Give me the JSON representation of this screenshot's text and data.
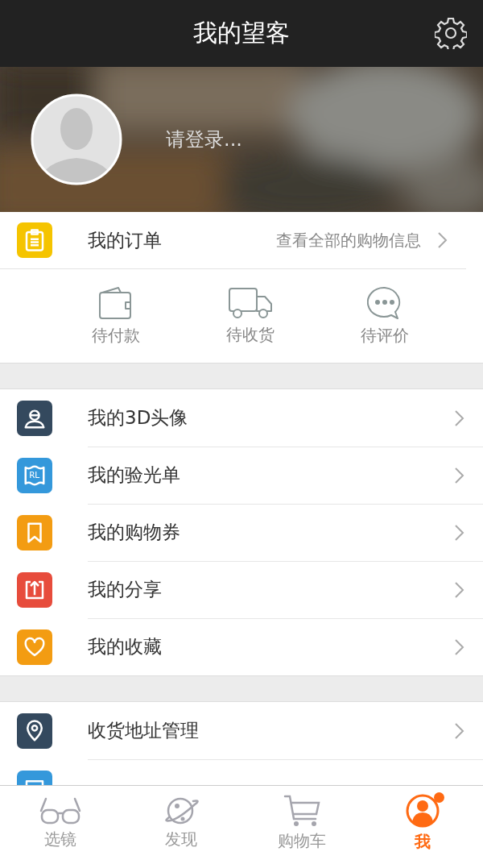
{
  "header": {
    "title": "我的望客"
  },
  "profile": {
    "login_prompt": "请登录..."
  },
  "orders": {
    "title": "我的订单",
    "link": "查看全部的购物信息",
    "statuses": [
      {
        "label": "待付款"
      },
      {
        "label": "待收货"
      },
      {
        "label": "待评价"
      }
    ]
  },
  "menu_groups": [
    {
      "items": [
        {
          "label": "我的3D头像",
          "color": "#34495e"
        },
        {
          "label": "我的验光单",
          "color": "#3498db",
          "icon_text": "RL"
        },
        {
          "label": "我的购物券",
          "color": "#f39c12"
        },
        {
          "label": "我的分享",
          "color": "#e74c3c"
        },
        {
          "label": "我的收藏",
          "color": "#f39c12"
        }
      ]
    },
    {
      "items": [
        {
          "label": "收货地址管理",
          "color": "#34495e"
        },
        {
          "color": "#3498db"
        }
      ]
    }
  ],
  "tab_bar": [
    {
      "label": "选镜",
      "selected": false,
      "badge": false
    },
    {
      "label": "发现",
      "selected": false,
      "badge": false
    },
    {
      "label": "购物车",
      "selected": false,
      "badge": false
    },
    {
      "label": "我",
      "selected": true,
      "badge": true
    }
  ]
}
